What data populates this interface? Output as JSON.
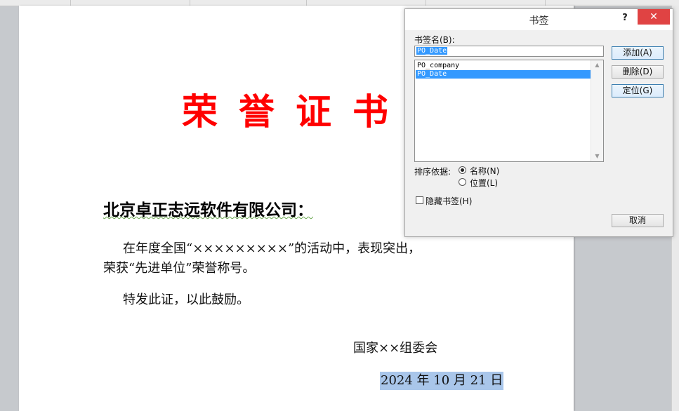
{
  "document": {
    "title": "荣誉证书",
    "recipient": "北京卓正志远软件有限公司：",
    "paragraph1_line1": "在年度全国“×××××××××”的活动中，表现突出，",
    "paragraph1_line2": "荣获“先进单位”荣誉称号。",
    "closing": "特发此证，以此鼓励。",
    "signatory": "国家××组委会",
    "date": "2024 年 10 月 21 日"
  },
  "dialog": {
    "title": "书签",
    "help_label": "?",
    "close_label": "✕",
    "name_label": "书签名(B):",
    "name_value": "PO_Date",
    "bookmarks": [
      "PO_company",
      "PO_Date"
    ],
    "selected_bookmark": "PO_Date",
    "buttons": {
      "add": "添加(A)",
      "delete": "删除(D)",
      "goto": "定位(G)",
      "cancel": "取消"
    },
    "sort_label": "排序依据:",
    "sort_options": [
      "名称(N)",
      "位置(L)"
    ],
    "sort_selected": "名称(N)",
    "hidden_label": "隐藏书签(H)",
    "hidden_checked": false
  },
  "colors": {
    "title_red": "#ff0000",
    "selection_blue": "#3399ff",
    "date_highlight": "#a9c6ea",
    "close_red": "#e04343"
  }
}
